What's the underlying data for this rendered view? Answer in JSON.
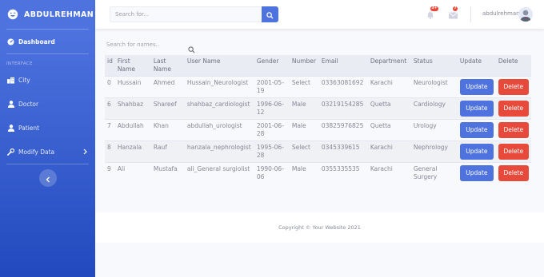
{
  "brand": {
    "name": "ABDULREHMAN",
    "icon": "laugh-wink-icon"
  },
  "sidebar": {
    "dashboard": "Dashboard",
    "heading": "INTERFACE",
    "items": [
      {
        "label": "City",
        "icon": "city-icon"
      },
      {
        "label": "Doctor",
        "icon": "user-icon"
      },
      {
        "label": "Patient",
        "icon": "user-icon"
      },
      {
        "label": "Modify Data",
        "icon": "wrench-icon"
      }
    ]
  },
  "topbar": {
    "search_placeholder": "Search for...",
    "alerts_badge": "3+",
    "messages_badge": "7",
    "username": "abdulrehman"
  },
  "table": {
    "search_placeholder": "Search for names..",
    "headers": [
      "id",
      "First Name",
      "Last Name",
      "User Name",
      "Gender",
      "Number",
      "Email",
      "Department",
      "Status",
      "Update",
      "Delete"
    ],
    "rows": [
      [
        "0",
        "Hussain",
        "Ahmed",
        "Hussain_Neurologist",
        "2001-05-19",
        "Select",
        "03363081692",
        "Karachi",
        "Neurologist"
      ],
      [
        "6",
        "Shahbaz",
        "Shareef",
        "shahbaz_cardiologist",
        "1996-06-12",
        "Male",
        "03219154285",
        "Quetta",
        "Cardiology"
      ],
      [
        "7",
        "Abdullah",
        "Khan",
        "abdullah_urologist",
        "2001-06-28",
        "Male",
        "03825976825",
        "Quetta",
        "Urology"
      ],
      [
        "8",
        "Hanzala",
        "Rauf",
        "hanzala_nephrologist",
        "1995-06-28",
        "Select",
        "0345339615",
        "Karachi",
        "Nephrology"
      ],
      [
        "9",
        "Ali",
        "Mustafa",
        "ali_General surgiolist",
        "1990-06-06",
        "Male",
        "0355335535",
        "Karachi",
        "General Surgery"
      ]
    ],
    "update_label": "Update",
    "delete_label": "Delete"
  },
  "footer": {
    "copyright": "Copyright © Your Website 2021"
  },
  "colors": {
    "primary": "#4e73df",
    "danger": "#e74a3b",
    "sidebar_dark": "#224abe"
  }
}
